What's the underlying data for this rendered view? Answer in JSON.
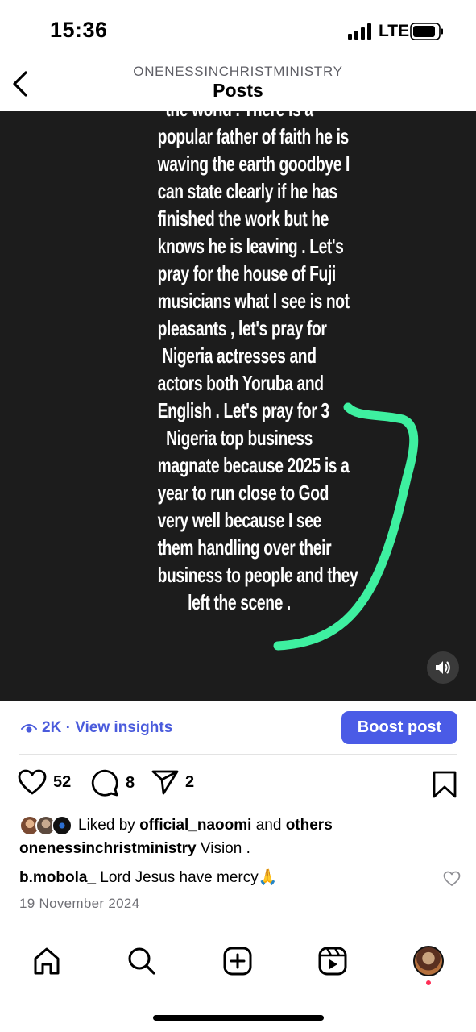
{
  "status": {
    "time": "15:36",
    "network": "LTE"
  },
  "header": {
    "account": "ONENESSINCHRISTMINISTRY",
    "title": "Posts"
  },
  "post": {
    "text_lines": [
      "the world . There is a",
      "popular father of faith he is",
      "waving the earth goodbye  I",
      "can state  clearly if he has",
      "finished the work but he",
      "knows he is leaving .  Let's",
      "pray for the house of Fuji",
      "musicians what I see is not",
      "pleasants , let's pray for",
      "Nigeria actresses and",
      "actors both Yoruba and",
      "English .  Let's pray for 3",
      "Nigeria top business",
      "magnate because 2025 is a",
      "year to run close to God",
      "very well because I see",
      "them handling over their",
      "business to people and they",
      "left the scene ."
    ],
    "annotation_color": "#3ef0a0"
  },
  "insights": {
    "views": "2K",
    "separator": " · ",
    "link_label": "View insights",
    "boost_label": "Boost post"
  },
  "actions": {
    "likes": "52",
    "comments": "8",
    "shares": "2"
  },
  "likes_line": {
    "prefix": "Liked by",
    "user": "official_naoomi",
    "connector": "and",
    "others": "others"
  },
  "caption": {
    "user": "onenessinchristministry",
    "text": "Vision ."
  },
  "comment": {
    "user": "b.mobola_",
    "text": "Lord Jesus have mercy🙏"
  },
  "date": "19 November 2024",
  "colors": {
    "accent": "#4a5be6",
    "link": "#4a5bdc",
    "media_bg": "#1c1c1c",
    "notification": "#ff2d55"
  }
}
